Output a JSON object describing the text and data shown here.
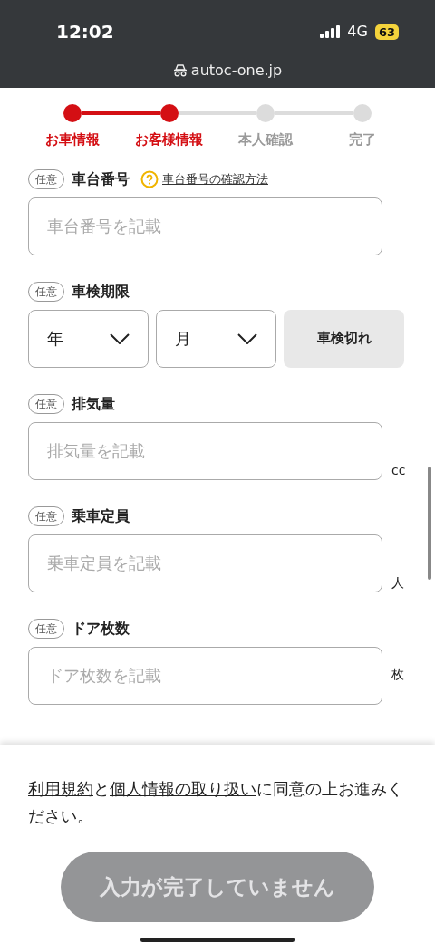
{
  "status_bar": {
    "time": "12:02",
    "network": "4G",
    "battery": "63",
    "url": "autoc-one.jp"
  },
  "steps": [
    {
      "label": "お車情報",
      "completed": true
    },
    {
      "label": "お客様情報",
      "completed": true
    },
    {
      "label": "本人確認",
      "completed": false
    },
    {
      "label": "完了",
      "completed": false
    }
  ],
  "fields": [
    {
      "kind": "text",
      "badge": "任意",
      "label": "車台番号",
      "help_link": "車台番号の確認方法",
      "placeholder": "車台番号を記載"
    },
    {
      "kind": "date",
      "badge": "任意",
      "label": "車検期限",
      "selects": [
        "年",
        "月"
      ],
      "button": "車検切れ"
    },
    {
      "kind": "text",
      "badge": "任意",
      "label": "排気量",
      "placeholder": "排気量を記載",
      "unit": "cc"
    },
    {
      "kind": "text",
      "badge": "任意",
      "label": "乗車定員",
      "placeholder": "乗車定員を記載",
      "unit": "人"
    },
    {
      "kind": "text",
      "badge": "任意",
      "label": "ドア枚数",
      "placeholder": "ドア枚数を記載",
      "unit": "枚"
    }
  ],
  "consent": [
    {
      "kind": "link",
      "text": "利用規約"
    },
    {
      "kind": "text",
      "text": "と"
    },
    {
      "kind": "link",
      "text": "個人情報の取り扱い"
    },
    {
      "kind": "text",
      "text": "に同意の上お進みください。"
    }
  ],
  "submit": {
    "label": "入力が完了していません",
    "disabled": true
  }
}
